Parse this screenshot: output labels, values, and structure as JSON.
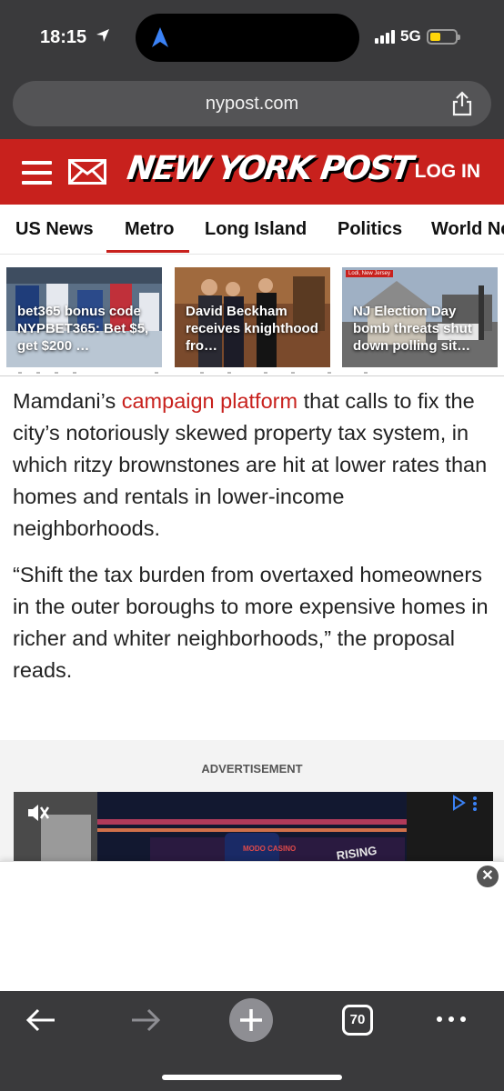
{
  "status": {
    "time": "18:15",
    "network": "5G"
  },
  "browser": {
    "url": "nypost.com",
    "tab_count": "70"
  },
  "header": {
    "logo": "NEW YORK POST",
    "login": "LOG IN",
    "brand_color": "#c8211d"
  },
  "sections": [
    {
      "label": "US News"
    },
    {
      "label": "Metro",
      "active": true
    },
    {
      "label": "Long Island"
    },
    {
      "label": "Politics"
    },
    {
      "label": "World News"
    }
  ],
  "stories": [
    {
      "caption": "bet365 bonus code NYPBET365: Bet $5, get $200 …"
    },
    {
      "caption": "David Beckham receives knighthood fro…"
    },
    {
      "caption": "NJ Election Day bomb threats shut down polling sit…",
      "tag": "Lodi, New Jersey"
    }
  ],
  "article": {
    "p1_before": "Mamdani’s ",
    "p1_link": "campaign platform",
    "p1_after": " that calls to fix the city’s notoriously skewed property tax system, in which ritzy brownstones are hit at lower rates than homes and rentals in lower-income neighborhoods.",
    "p2": "“Shift the tax burden from overtaxed homeowners in the outer boroughs to more expensive homes in richer and whiter neighborhoods,” the proposal reads."
  },
  "ad": {
    "label": "ADVERTISEMENT",
    "video_text": "RISING",
    "sponsor_text": "MODO CASINO"
  },
  "icons": {
    "location": "location-arrow-icon",
    "share": "share-icon",
    "menu": "hamburger-menu-icon",
    "mail": "mail-icon",
    "mute": "mute-icon",
    "adchoices": "adchoices-icon",
    "close": "close-icon",
    "back": "back-arrow-icon",
    "forward": "forward-arrow-icon",
    "new_tab": "plus-icon",
    "more": "more-dots-icon"
  }
}
